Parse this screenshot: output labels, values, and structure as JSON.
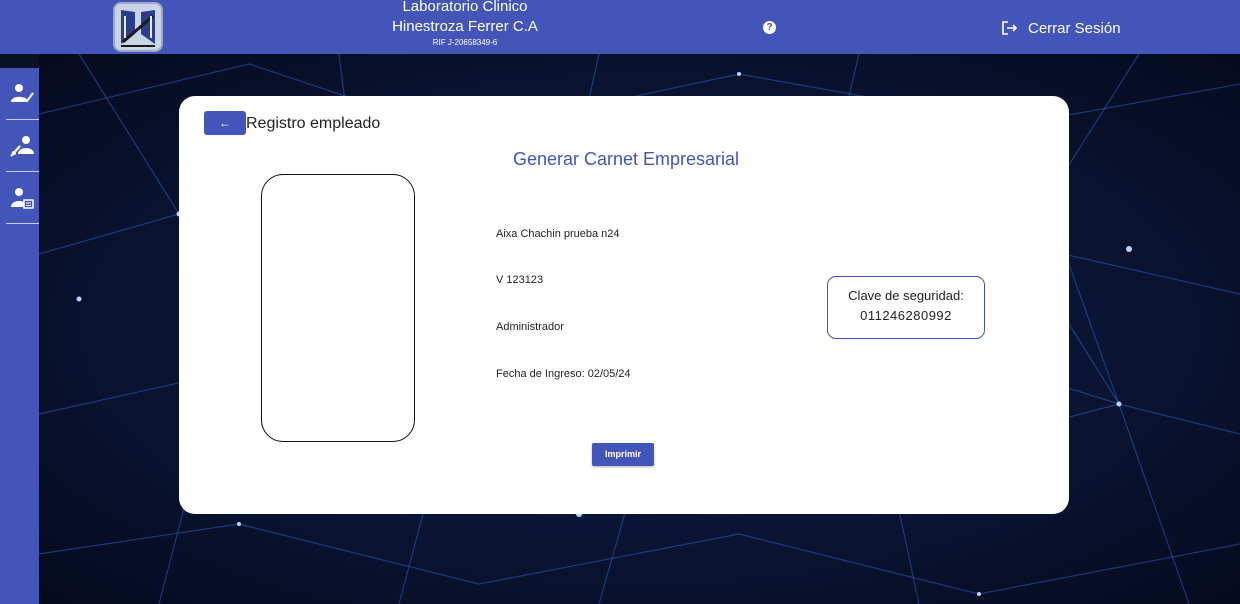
{
  "header": {
    "title_line1": "Laboratorio Clinico",
    "title_line2": "Hinestroza Ferrer C.A",
    "rif": "RIF J-20658349-6",
    "help_label": "?",
    "logout_label": "Cerrar Sesión"
  },
  "sidebar": {
    "items": [
      {
        "icon": "user-check-icon"
      },
      {
        "icon": "medical-staff-icon"
      },
      {
        "icon": "user-settings-icon"
      }
    ]
  },
  "card": {
    "back_label": "←",
    "title": "Registro empleado",
    "heading": "Generar Carnet Empresarial",
    "employee_name": "Aixa Chachin prueba n24",
    "employee_id": "V 123123",
    "employee_role": "Administrador",
    "hire_date": "Fecha de Ingreso: 02/05/24",
    "security_label": "Clave de seguridad:",
    "security_code": "011246280992",
    "print_label": "Imprimir"
  },
  "colors": {
    "brand_blue": "#4355b9",
    "background": "#0a1026",
    "card": "#ffffff"
  }
}
